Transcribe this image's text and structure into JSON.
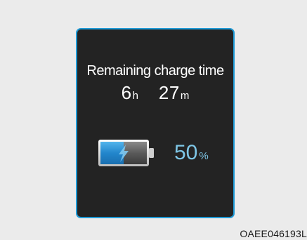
{
  "display": {
    "title": "Remaining charge time",
    "hours_value": "6",
    "hours_unit": "h",
    "minutes_value": "27",
    "minutes_unit": "m",
    "battery_percent_value": "50",
    "battery_percent_unit": "%",
    "battery_level_fraction": 0.5,
    "battery_icon": "battery-charging-icon"
  },
  "figure_code": "OAEE046193L",
  "colors": {
    "frame_border": "#1e9ad6",
    "screen_background": "#232323",
    "battery_fill": "#2b8fd4",
    "percent_text": "#7ec6e6"
  }
}
